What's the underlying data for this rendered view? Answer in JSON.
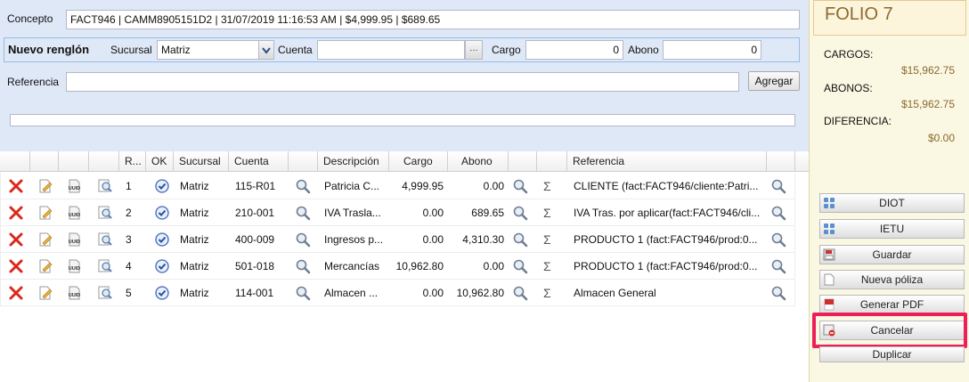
{
  "form": {
    "concepto_label": "Concepto",
    "concepto_value": "FACT946 | CAMM8905151D2 | 31/07/2019 11:16:53 AM | $4,999.95 | $689.65",
    "nuevo_renglon_label": "Nuevo renglón",
    "sucursal_label": "Sucursal",
    "sucursal_value": "Matriz",
    "cuenta_label": "Cuenta",
    "cuenta_value": "",
    "cuenta_button": "…",
    "cargo_label": "Cargo",
    "cargo_value": "0",
    "abono_label": "Abono",
    "abono_value": "0",
    "referencia_label": "Referencia",
    "referencia_value": "",
    "agregar_label": "Agregar"
  },
  "grid": {
    "headers": {
      "renglon": "R...",
      "ok": "OK",
      "sucursal": "Sucursal",
      "cuenta": "Cuenta",
      "descripcion": "Descripción",
      "cargo": "Cargo",
      "abono": "Abono",
      "referencia": "Referencia"
    },
    "rows": [
      {
        "n": "1",
        "sucursal": "Matriz",
        "cuenta": "115-R01",
        "descripcion": "Patricia C...",
        "cargo": "4,999.95",
        "abono": "0.00",
        "referencia": "CLIENTE (fact:FACT946/cliente:Patri..."
      },
      {
        "n": "2",
        "sucursal": "Matriz",
        "cuenta": "210-001",
        "descripcion": "IVA Trasla...",
        "cargo": "0.00",
        "abono": "689.65",
        "referencia": "IVA Tras. por aplicar(fact:FACT946/cli..."
      },
      {
        "n": "3",
        "sucursal": "Matriz",
        "cuenta": "400-009",
        "descripcion": "Ingresos p...",
        "cargo": "0.00",
        "abono": "4,310.30",
        "referencia": "PRODUCTO 1 (fact:FACT946/prod:0..."
      },
      {
        "n": "4",
        "sucursal": "Matriz",
        "cuenta": "501-018",
        "descripcion": "Mercancías",
        "cargo": "10,962.80",
        "abono": "0.00",
        "referencia": "PRODUCTO 1 (fact:FACT946/prod:0..."
      },
      {
        "n": "5",
        "sucursal": "Matriz",
        "cuenta": "114-001",
        "descripcion": "Almacen ...",
        "cargo": "0.00",
        "abono": "10,962.80",
        "referencia": "Almacen General"
      }
    ],
    "sigma": "Σ",
    "uuid_label": "UUID"
  },
  "side": {
    "folio": "FOLIO 7",
    "cargos_label": "CARGOS:",
    "cargos_value": "$15,962.75",
    "abonos_label": "ABONOS:",
    "abonos_value": "$15,962.75",
    "diferencia_label": "DIFERENCIA:",
    "diferencia_value": "$0.00",
    "buttons": {
      "diot": "DIOT",
      "ietu": "IETU",
      "guardar": "Guardar",
      "nueva_poliza": "Nueva póliza",
      "generar_pdf": "Generar PDF",
      "cancelar": "Cancelar",
      "duplicar": "Duplicar"
    }
  },
  "colors": {
    "panel_bg": "#dfe8f6",
    "side_bg": "#faf7e2",
    "amount_text": "#8a6a2f",
    "highlight": "#ee1e5a"
  }
}
